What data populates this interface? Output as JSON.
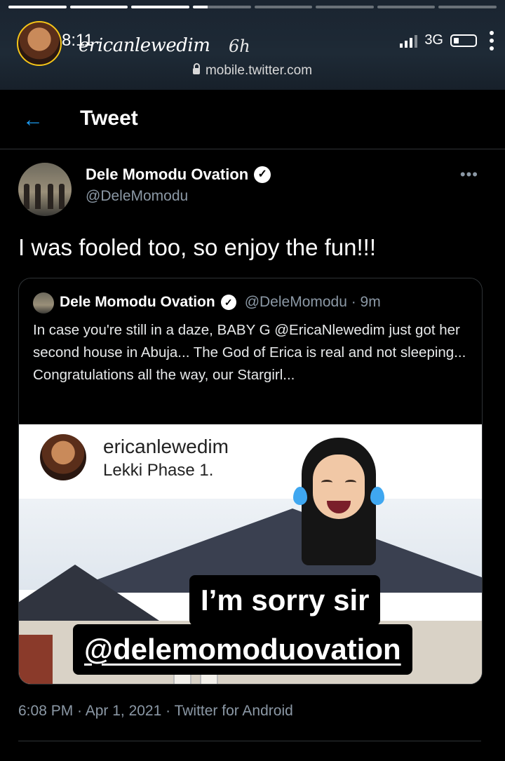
{
  "story": {
    "time": "8:11",
    "username": "ericanlewedim",
    "age": "6h",
    "network": "3G",
    "url": "mobile.twitter.com"
  },
  "header": {
    "back_icon": "arrow-left-icon",
    "title": "Tweet"
  },
  "tweet": {
    "author_name": "Dele Momodu Ovation",
    "handle": "@DeleMomodu",
    "more": "•••",
    "text": "I was fooled too, so enjoy the fun!!!",
    "timestamp": "6:08 PM · Apr 1, 2021 · Twitter for Android"
  },
  "quoted": {
    "author_name": "Dele Momodu Ovation",
    "meta": "@DeleMomodu · 9m",
    "text": "In case you're still in a daze, BABY G @EricaNlewedim just got her second house in Abuja... The God of Erica is real and not sleeping... Congratulations all the way, our Stargirl...",
    "image": {
      "username": "ericanlewedim",
      "location": "Lekki Phase 1."
    }
  },
  "stickers": {
    "line1": "I’m sorry sir",
    "line2": "@delemomoduovation"
  },
  "colors": {
    "accent": "#1d9bf0",
    "muted": "#8b98a5",
    "divider": "#2f3336"
  }
}
